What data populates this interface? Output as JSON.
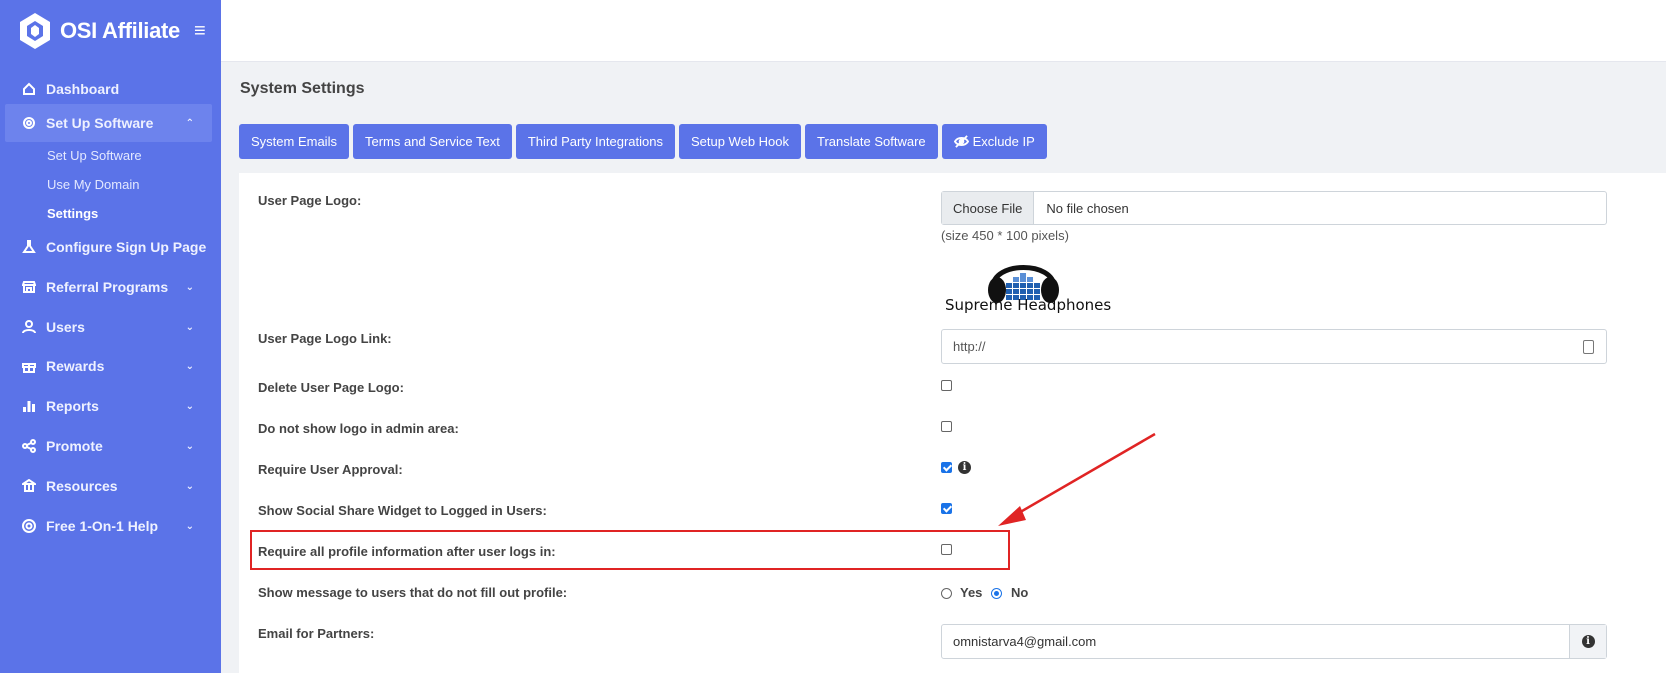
{
  "brand": {
    "name": "OSI Affiliate",
    "menu_icon": "hamburger-icon"
  },
  "sidebar": {
    "items": [
      {
        "label": "Dashboard",
        "icon": "home-icon"
      },
      {
        "label": "Set Up Software",
        "icon": "gear-icon",
        "expanded": true
      },
      {
        "label": "Configure Sign Up Page",
        "icon": "flask-icon"
      },
      {
        "label": "Referral Programs",
        "icon": "store-icon"
      },
      {
        "label": "Users",
        "icon": "user-icon"
      },
      {
        "label": "Rewards",
        "icon": "gift-icon"
      },
      {
        "label": "Reports",
        "icon": "bar-chart-icon"
      },
      {
        "label": "Promote",
        "icon": "share-icon"
      },
      {
        "label": "Resources",
        "icon": "bank-icon"
      },
      {
        "label": "Free 1-On-1 Help",
        "icon": "lifebuoy-icon"
      }
    ],
    "sub_items": [
      "Set Up Software",
      "Use My Domain",
      "Settings"
    ],
    "accent": "#5b73e8"
  },
  "page": {
    "title": "System Settings"
  },
  "tabs": [
    "System Emails",
    "Terms and Service Text",
    "Third Party Integrations",
    "Setup Web Hook",
    "Translate Software",
    "Exclude IP"
  ],
  "form": {
    "logo_label": "User Page Logo:",
    "file_button": "Choose File",
    "file_status": "No file chosen",
    "size_hint": "(size 450 * 100 pixels)",
    "logo_caption": "Supreme Headphones",
    "logo_link_label": "User Page Logo Link:",
    "logo_link_value": "http://",
    "delete_logo_label": "Delete User Page Logo:",
    "delete_logo_checked": false,
    "no_logo_admin_label": "Do not show logo in admin area:",
    "no_logo_admin_checked": false,
    "require_approval_label": "Require User Approval:",
    "require_approval_checked": true,
    "social_share_label": "Show Social Share Widget to Logged in Users:",
    "social_share_checked": true,
    "require_profile_label": "Require all profile information after user logs in:",
    "require_profile_checked": false,
    "show_message_label": "Show message to users that do not fill out profile:",
    "show_message_yes": "Yes",
    "show_message_no": "No",
    "show_message_value": "No",
    "email_label": "Email for Partners:",
    "email_value": "omnistarva4@gmail.com"
  },
  "annotation": {
    "color": "#e02424"
  }
}
